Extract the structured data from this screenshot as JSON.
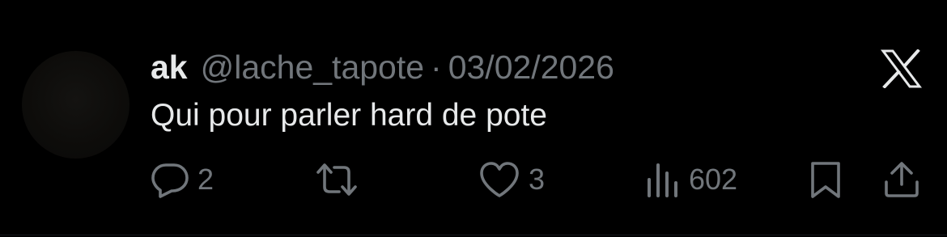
{
  "tweet": {
    "author": {
      "name": "ak",
      "handle": "@lache_tapote"
    },
    "separator": "·",
    "date": "03/02/2026",
    "text": "Qui pour parler hard de pote",
    "platform_icon": "x-logo-icon"
  },
  "actions": {
    "reply": {
      "icon": "reply-icon",
      "count": "2"
    },
    "repost": {
      "icon": "repost-icon",
      "count": ""
    },
    "like": {
      "icon": "heart-icon",
      "count": "3"
    },
    "views": {
      "icon": "views-chart-icon",
      "count": "602"
    },
    "bookmark": {
      "icon": "bookmark-icon"
    },
    "share": {
      "icon": "share-icon"
    }
  },
  "colors": {
    "background": "#000000",
    "primary_text": "#e7e9ea",
    "secondary_text": "#71767b"
  }
}
